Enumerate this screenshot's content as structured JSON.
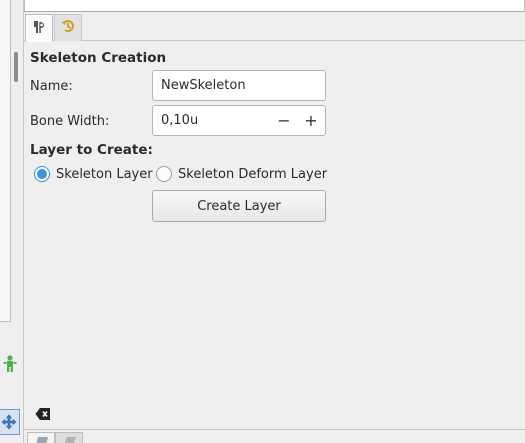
{
  "panel": {
    "skeleton_creation_title": "Skeleton Creation",
    "name_label": "Name:",
    "name_value": "NewSkeleton",
    "bone_width_label": "Bone Width:",
    "bone_width_value": "0,10u",
    "decrement_symbol": "−",
    "increment_symbol": "+",
    "layer_to_create_title": "Layer to Create:",
    "layer_options": [
      {
        "label": "Skeleton Layer",
        "checked": true
      },
      {
        "label": "Skeleton Deform Layer",
        "checked": false
      }
    ],
    "create_layer_label": "Create Layer"
  },
  "tabs": [
    {
      "icon": "params-icon",
      "active": true
    },
    {
      "icon": "history-icon",
      "active": false
    }
  ],
  "icons": {
    "left_figure": "skeleton-figure-icon",
    "left_tool": "transform-tool-icon",
    "clear": "clear-backspace-icon"
  },
  "colors": {
    "accent": "#3d93dc",
    "background": "#efefef",
    "figure_green": "#4caf50"
  }
}
